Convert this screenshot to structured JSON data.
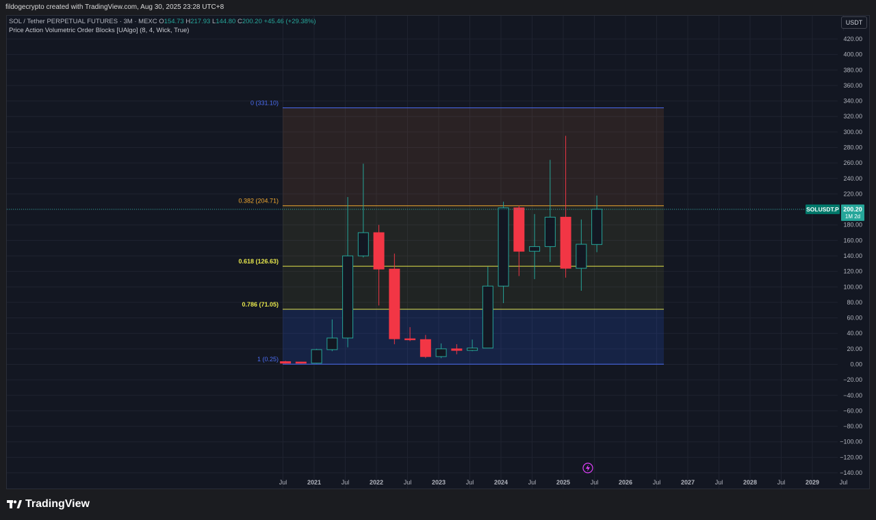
{
  "header": {
    "credit": "fildogecrypto created with TradingView.com, Aug 30, 2025 23:28 UTC+8"
  },
  "legend": {
    "symbol_line": "SOL / Tether PERPETUAL FUTURES · 3M · MEXC",
    "open_label": "O",
    "open": "154.73",
    "high_label": "H",
    "high": "217.93",
    "low_label": "L",
    "low": "144.80",
    "close_label": "C",
    "close": "200.20",
    "change": "+45.46 (+29.38%)",
    "indicator": "Price Action Volumetric Order Blocks [UAlgo] (8, 4, Wick, True)"
  },
  "currency_button": "USDT",
  "price_tag": {
    "symbol": "SOLUSDT.P",
    "price": "200.20",
    "countdown": "1M 2d"
  },
  "colors": {
    "up": "#26a69a",
    "down": "#f23645",
    "background": "#131722",
    "grid": "#1f2330",
    "fib_0": "#4c6ef5",
    "fib_0382": "#f0a830",
    "fib_0618": "#e6e64c",
    "fib_0786": "#e6e64c",
    "fib_1": "#4c6ef5"
  },
  "chart_data": {
    "type": "candlestick",
    "timeframe": "3M",
    "y_axis": {
      "range": [
        -140,
        420
      ],
      "ticks": [
        420,
        400,
        380,
        360,
        340,
        320,
        300,
        280,
        260,
        240,
        220,
        200,
        180,
        160,
        140,
        120,
        100,
        80,
        60,
        40,
        20,
        0,
        -20,
        -40,
        -60,
        -80,
        -100,
        -120,
        -140
      ],
      "tick_labels": [
        "420.00",
        "400.00",
        "380.00",
        "360.00",
        "340.00",
        "320.00",
        "300.00",
        "280.00",
        "260.00",
        "240.00",
        "220.00",
        "200.00",
        "180.00",
        "160.00",
        "140.00",
        "120.00",
        "100.00",
        "80.00",
        "60.00",
        "40.00",
        "20.00",
        "0.00",
        "−20.00",
        "−40.00",
        "−60.00",
        "−80.00",
        "−100.00",
        "−120.00",
        "−140.00"
      ]
    },
    "x_axis": {
      "range": [
        "2020-04",
        "2029-10"
      ],
      "ticks": [
        {
          "t": "2020-07",
          "label": "Jul"
        },
        {
          "t": "2021-01",
          "label": "2021"
        },
        {
          "t": "2021-07",
          "label": "Jul"
        },
        {
          "t": "2022-01",
          "label": "2022"
        },
        {
          "t": "2022-07",
          "label": "Jul"
        },
        {
          "t": "2023-01",
          "label": "2023"
        },
        {
          "t": "2023-07",
          "label": "Jul"
        },
        {
          "t": "2024-01",
          "label": "2024"
        },
        {
          "t": "2024-07",
          "label": "Jul"
        },
        {
          "t": "2025-01",
          "label": "2025"
        },
        {
          "t": "2025-07",
          "label": "Jul"
        },
        {
          "t": "2026-01",
          "label": "2026"
        },
        {
          "t": "2026-07",
          "label": "Jul"
        },
        {
          "t": "2027-01",
          "label": "2027"
        },
        {
          "t": "2027-07",
          "label": "Jul"
        },
        {
          "t": "2028-01",
          "label": "2028"
        },
        {
          "t": "2028-07",
          "label": "Jul"
        },
        {
          "t": "2029-01",
          "label": "2029"
        },
        {
          "t": "2029-07",
          "label": "Jul"
        }
      ]
    },
    "candles": [
      {
        "t": "2020-07",
        "o": 3.5,
        "h": 4.5,
        "l": 1.0,
        "c": 1.5
      },
      {
        "t": "2020-10",
        "o": 3.0,
        "h": 3.5,
        "l": 1.0,
        "c": 1.5
      },
      {
        "t": "2021-01",
        "o": 1.5,
        "h": 20,
        "l": 1.0,
        "c": 19
      },
      {
        "t": "2021-04",
        "o": 19,
        "h": 58,
        "l": 17,
        "c": 34
      },
      {
        "t": "2021-07",
        "o": 34,
        "h": 216,
        "l": 22,
        "c": 140
      },
      {
        "t": "2021-10",
        "o": 140,
        "h": 259,
        "l": 138,
        "c": 170
      },
      {
        "t": "2022-01",
        "o": 170,
        "h": 180,
        "l": 76,
        "c": 123
      },
      {
        "t": "2022-04",
        "o": 123,
        "h": 143,
        "l": 26,
        "c": 33
      },
      {
        "t": "2022-07",
        "o": 33,
        "h": 48,
        "l": 30,
        "c": 32
      },
      {
        "t": "2022-10",
        "o": 32,
        "h": 38,
        "l": 8,
        "c": 10
      },
      {
        "t": "2023-01",
        "o": 10,
        "h": 27,
        "l": 8,
        "c": 20
      },
      {
        "t": "2023-04",
        "o": 20,
        "h": 26,
        "l": 13,
        "c": 18
      },
      {
        "t": "2023-07",
        "o": 18,
        "h": 32,
        "l": 17,
        "c": 21
      },
      {
        "t": "2023-10",
        "o": 21,
        "h": 126,
        "l": 21,
        "c": 101
      },
      {
        "t": "2024-01",
        "o": 101,
        "h": 210,
        "l": 79,
        "c": 202
      },
      {
        "t": "2024-04",
        "o": 202,
        "h": 205,
        "l": 114,
        "c": 146
      },
      {
        "t": "2024-07",
        "o": 146,
        "h": 194,
        "l": 110,
        "c": 152
      },
      {
        "t": "2024-10",
        "o": 152,
        "h": 264,
        "l": 132,
        "c": 190
      },
      {
        "t": "2025-01",
        "o": 190,
        "h": 295,
        "l": 112,
        "c": 124
      },
      {
        "t": "2025-04",
        "o": 124,
        "h": 187,
        "l": 95,
        "c": 155
      },
      {
        "t": "2025-07",
        "o": 154.73,
        "h": 217.93,
        "l": 144.8,
        "c": 200.2
      }
    ],
    "fib_levels": [
      {
        "ratio": "0",
        "value": 331.1,
        "label": "0 (331.10)"
      },
      {
        "ratio": "0.382",
        "value": 204.71,
        "label": "0.382 (204.71)"
      },
      {
        "ratio": "0.618",
        "value": 126.63,
        "label": "0.618 (126.63)"
      },
      {
        "ratio": "0.786",
        "value": 71.05,
        "label": "0.786 (71.05)"
      },
      {
        "ratio": "1",
        "value": 0.25,
        "label": "1 (0.25)"
      }
    ],
    "fib_range": {
      "start": "2020-04",
      "end": "2026-07"
    },
    "current_price": 200.2,
    "grid": true
  }
}
